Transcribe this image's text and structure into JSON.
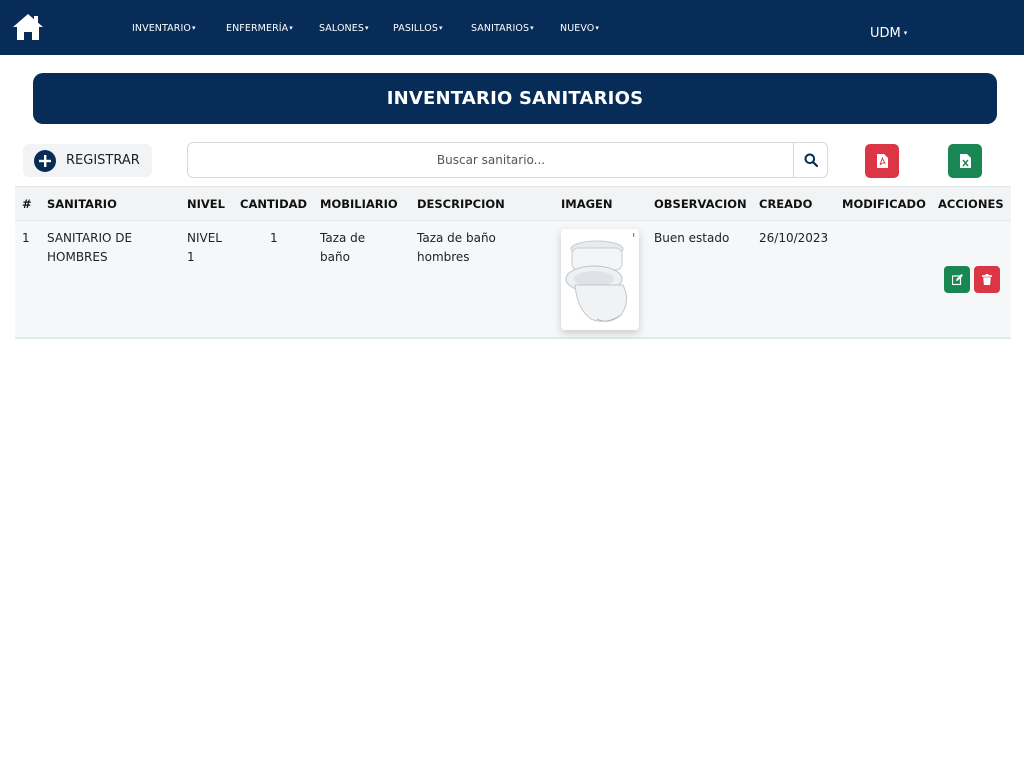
{
  "navbar": {
    "home_icon": "home-icon",
    "items": [
      {
        "label": "INVENTARIO"
      },
      {
        "label": "ENFERMERÍA"
      },
      {
        "label": "SALONES"
      },
      {
        "label": "PASILLOS"
      },
      {
        "label": "SANITARIOS"
      },
      {
        "label": "NUEVO"
      }
    ],
    "caret": "▾",
    "user_menu": "UDM"
  },
  "page": {
    "title": "INVENTARIO SANITARIOS"
  },
  "toolbar": {
    "register_label": "REGISTRAR",
    "search_placeholder": "Buscar sanitario...",
    "search_icon": "search-icon",
    "pdf_icon": "file-pdf-icon",
    "excel_icon": "file-excel-icon"
  },
  "table": {
    "headers": [
      "#",
      "SANITARIO",
      "NIVEL",
      "CANTIDAD",
      "MOBILIARIO",
      "DESCRIPCION",
      "IMAGEN",
      "OBSERVACION",
      "CREADO",
      "MODIFICADO",
      "ACCIONES"
    ],
    "rows": [
      {
        "id": "1",
        "sanitario": "SANITARIO DE HOMBRES",
        "nivel": "NIVEL 1",
        "cantidad": "1",
        "mobiliario": "Taza de baño",
        "descripcion": "Taza de baño hombres",
        "imagen": "toilet-image",
        "observacion": "Buen estado",
        "creado": "26/10/2023",
        "modificado": ""
      }
    ]
  },
  "colors": {
    "navy": "#062c57",
    "danger": "#dc3545",
    "success": "#198754",
    "header_bg": "#f1f3f5"
  }
}
